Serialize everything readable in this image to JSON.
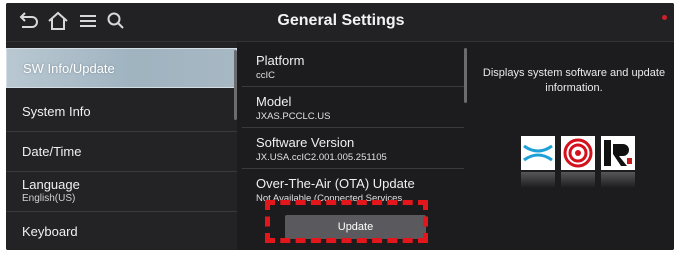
{
  "header": {
    "title": "General Settings",
    "icons": [
      "back-icon",
      "home-icon",
      "menu-icon",
      "search-icon"
    ]
  },
  "sidebar": {
    "items": [
      {
        "label": "SW Info/Update",
        "active": true
      },
      {
        "label": "System Info"
      },
      {
        "label": "Date/Time"
      },
      {
        "label": "Language",
        "sub": "English(US)"
      },
      {
        "label": "Keyboard"
      }
    ]
  },
  "info": {
    "rows": [
      {
        "label": "Platform",
        "value": "ccIC"
      },
      {
        "label": "Model",
        "value": "JXAS.PCCLC.US"
      },
      {
        "label": "Software Version",
        "value": "JX.USA.ccIC2.001.005.251105"
      },
      {
        "label": "Over-The-Air (OTA) Update",
        "value": "Not Available (Connected Services"
      }
    ],
    "update_label": "Update"
  },
  "right_panel": {
    "description": "Displays system software and update information.",
    "logos": [
      "bluetooth-sig-logo",
      "red-dot-award-logo",
      "ir52-award-logo"
    ]
  },
  "colors": {
    "background": "#1c1c1e",
    "highlight": "#e3161c",
    "active_item": "#a7b8c3"
  }
}
